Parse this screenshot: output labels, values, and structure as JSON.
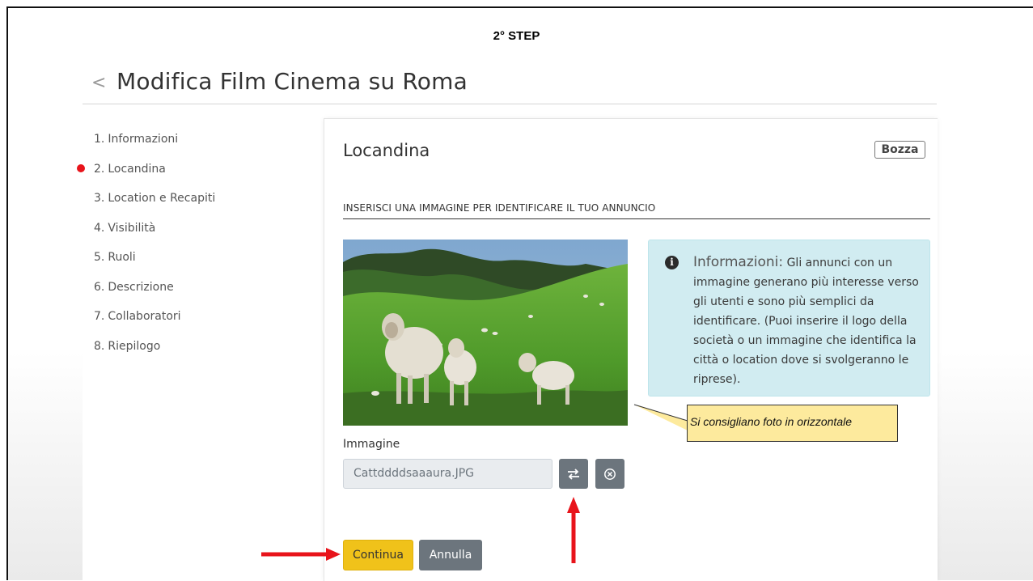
{
  "slide": {
    "step_title": "2° STEP"
  },
  "header": {
    "back_symbol": "<",
    "title": "Modifica Film Cinema su Roma"
  },
  "steps": [
    {
      "num": "1.",
      "label": "Informazioni"
    },
    {
      "num": "2.",
      "label": "Locandina",
      "active": true
    },
    {
      "num": "3.",
      "label": "Location e Recapiti"
    },
    {
      "num": "4.",
      "label": "Visibilità"
    },
    {
      "num": "5.",
      "label": "Ruoli"
    },
    {
      "num": "6.",
      "label": "Descrizione"
    },
    {
      "num": "7.",
      "label": "Collaboratori"
    },
    {
      "num": "8.",
      "label": "Riepilogo"
    }
  ],
  "card": {
    "title": "Locandina",
    "status_badge": "Bozza",
    "section_heading": "INSERISCI UNA IMMAGINE PER IDENTIFICARE IL TUO ANNUNCIO"
  },
  "info": {
    "icon": "info-circle-icon",
    "lead": "Informazioni:",
    "text": "Gli annunci con un immagine generano più interesse verso gli utenti e sono più semplici da identificare. (Puoi inserire il logo della società o un immagine che identifica la città o location dove si svolgeranno le riprese)."
  },
  "callout": {
    "text": "Si consigliano foto in orizzontale"
  },
  "image_field": {
    "label": "Immagine",
    "file_name": "Cattddddsaaaura.JPG",
    "replace_icon": "swap-arrows-icon",
    "remove_icon": "close-circle-icon"
  },
  "actions": {
    "continue_label": "Continua",
    "cancel_label": "Annulla"
  },
  "colors": {
    "marker_red": "#e8141b",
    "info_bg": "#d1ecf1",
    "callout_bg": "#fdea9d",
    "primary_button": "#f0c21a",
    "secondary_button": "#6c757d"
  }
}
